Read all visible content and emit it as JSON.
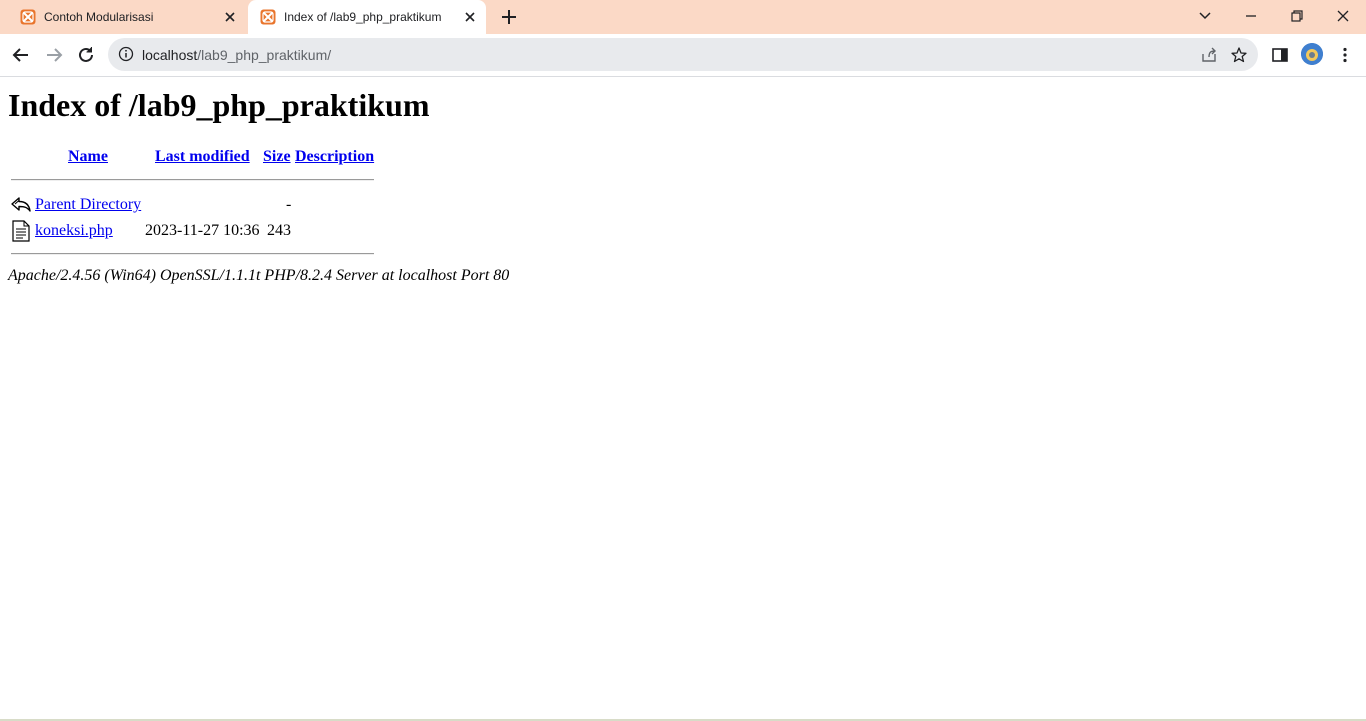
{
  "browser": {
    "tabs": [
      {
        "title": "Contoh Modularisasi",
        "active": false,
        "favicon": "xampp-icon"
      },
      {
        "title": "Index of /lab9_php_praktikum",
        "active": true,
        "favicon": "xampp-icon"
      }
    ],
    "url_host": "localhost",
    "url_path": "/lab9_php_praktikum/",
    "colors": {
      "tabstrip": "#fbd9c6",
      "favicon": "#e9752d",
      "link": "#0000ee"
    }
  },
  "page": {
    "heading": "Index of /lab9_php_praktikum",
    "columns": {
      "name": "Name",
      "last_modified": "Last modified",
      "size": "Size",
      "description": "Description"
    },
    "rows": [
      {
        "icon": "back-arrow-icon",
        "name": "Parent Directory",
        "modified": "",
        "size": "-",
        "description": ""
      },
      {
        "icon": "text-file-icon",
        "name": "koneksi.php",
        "modified": "2023-11-27 10:36",
        "size": "243",
        "description": ""
      }
    ],
    "footer": "Apache/2.4.56 (Win64) OpenSSL/1.1.1t PHP/8.2.4 Server at localhost Port 80"
  }
}
